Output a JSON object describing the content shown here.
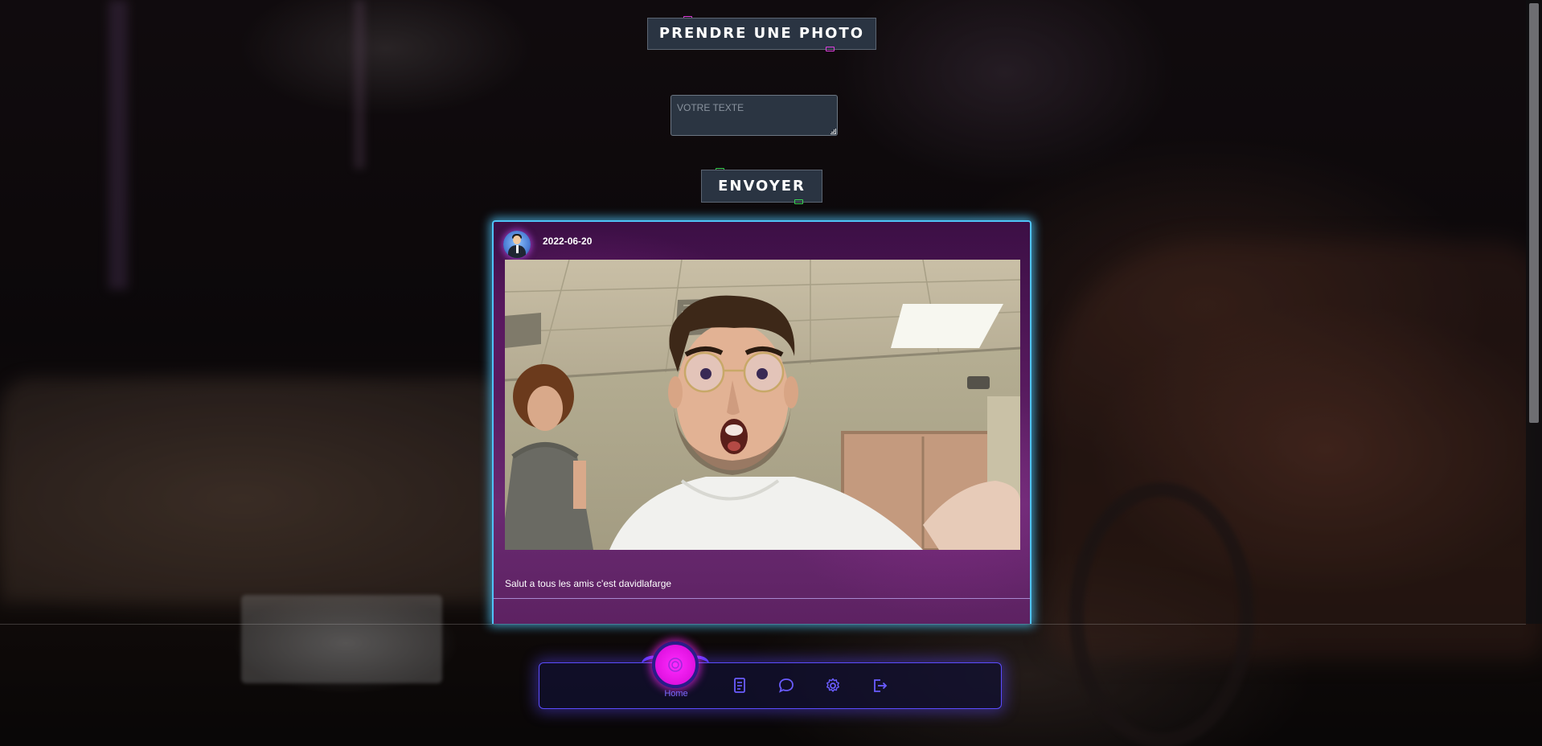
{
  "header": {
    "take_photo_label": "PRENDRE UNE PHOTO"
  },
  "composer": {
    "text_placeholder": "VOTRE TEXTE",
    "send_label": "ENVOYER"
  },
  "post": {
    "date": "2022-06-20",
    "caption": "Salut a tous les amis c'est davidlafarge"
  },
  "nav": {
    "items": [
      {
        "label": "Home",
        "icon": "home-icon",
        "active": true
      },
      {
        "label": "",
        "icon": "document-icon"
      },
      {
        "label": "",
        "icon": "chat-icon"
      },
      {
        "label": "",
        "icon": "gear-icon"
      },
      {
        "label": "",
        "icon": "logout-icon"
      }
    ]
  },
  "colors": {
    "accent_pink": "#e012e0",
    "nav_border": "#5b4cff",
    "card_glow": "#4fc3f7",
    "button_bg": "#2a3442"
  }
}
